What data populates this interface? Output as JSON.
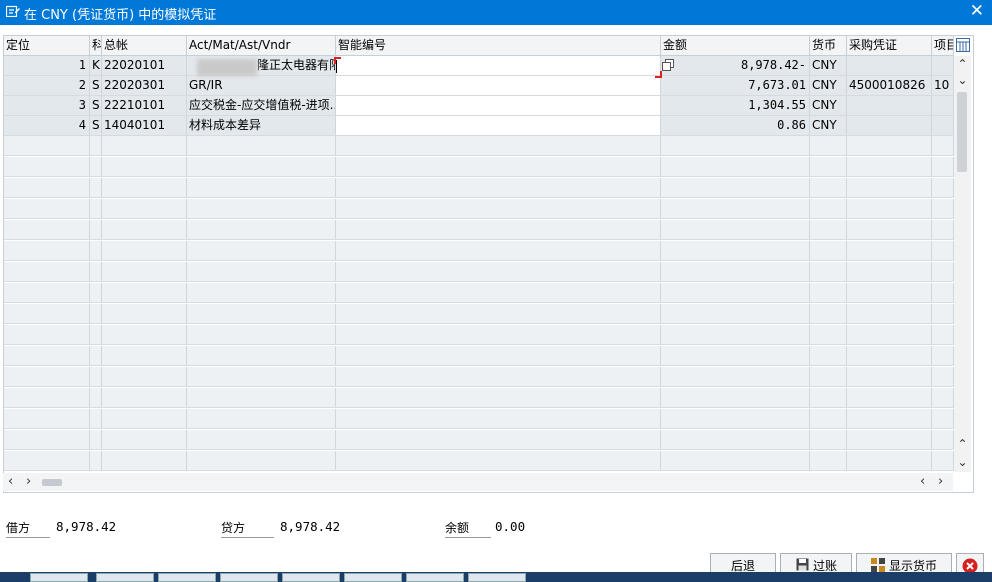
{
  "window": {
    "title": "在 CNY (凭证货币) 中的模拟凭证"
  },
  "columns": [
    {
      "key": "pos",
      "label": "定位"
    },
    {
      "key": "type",
      "label": "科"
    },
    {
      "key": "account",
      "label": "总帐"
    },
    {
      "key": "desc",
      "label": "Act/Mat/Ast/Vndr"
    },
    {
      "key": "smart",
      "label": "智能编号"
    },
    {
      "key": "amount",
      "label": "金额"
    },
    {
      "key": "currency",
      "label": "货币"
    },
    {
      "key": "po",
      "label": "采购凭证"
    },
    {
      "key": "item",
      "label": "项目"
    }
  ],
  "rows": [
    {
      "pos": "1",
      "type": "K",
      "account": "22020101",
      "desc": "隆正太电器有限...",
      "smart": "",
      "amount": "8,978.42-",
      "currency": "CNY",
      "po": "",
      "item": ""
    },
    {
      "pos": "2",
      "type": "S",
      "account": "22020301",
      "desc": "GR/IR",
      "smart": "",
      "amount": "7,673.01",
      "currency": "CNY",
      "po": "4500010826",
      "item": "10"
    },
    {
      "pos": "3",
      "type": "S",
      "account": "22210101",
      "desc": "应交税金-应交增值税-进项...",
      "smart": "",
      "amount": "1,304.55",
      "currency": "CNY",
      "po": "",
      "item": ""
    },
    {
      "pos": "4",
      "type": "S",
      "account": "14040101",
      "desc": "材料成本差异",
      "smart": "",
      "amount": "0.86",
      "currency": "CNY",
      "po": "",
      "item": ""
    }
  ],
  "totals": {
    "debit_label": "借方",
    "debit_value": "8,978.42",
    "credit_label": "贷方",
    "credit_value": "8,978.42",
    "balance_label": "余额",
    "balance_value": "0.00"
  },
  "buttons": {
    "back": "后退",
    "post": "过账",
    "show_currency": "显示货币"
  },
  "icons": {
    "title": "document-edit-icon",
    "close": "close-icon",
    "config": "table-config-icon",
    "copy": "copy-icon",
    "save": "save-icon",
    "currency": "display-currency-icon",
    "cancel": "cancel-icon"
  },
  "colors": {
    "titlebar": "#0078d7",
    "row_filled": "#e3e8ec",
    "focus_marker": "#dd2222",
    "cancel": "#d42020"
  }
}
